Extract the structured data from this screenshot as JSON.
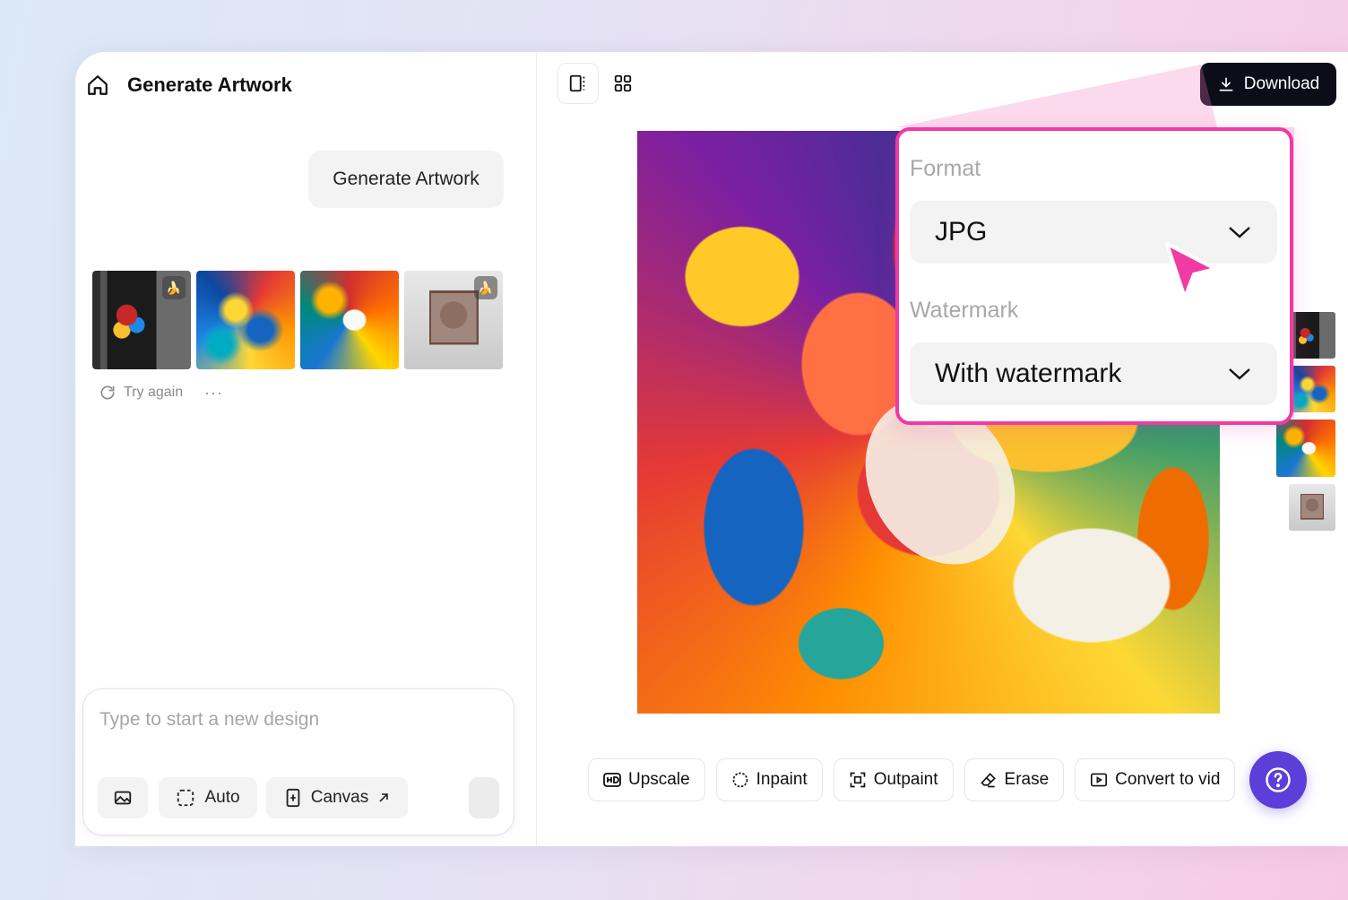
{
  "header": {
    "title": "Generate Artwork"
  },
  "chat": {
    "user_message": "Generate Artwork",
    "try_again_label": "Try again",
    "more_label": "···"
  },
  "composer": {
    "placeholder": "Type to start a new design",
    "auto_label": "Auto",
    "canvas_label": "Canvas"
  },
  "toolbar": {
    "download_label": "Download"
  },
  "popover": {
    "format_label": "Format",
    "format_value": "JPG",
    "watermark_label": "Watermark",
    "watermark_value": "With watermark"
  },
  "actions": [
    {
      "label": "Upscale",
      "icon": "hd-icon"
    },
    {
      "label": "Inpaint",
      "icon": "brush-icon"
    },
    {
      "label": "Outpaint",
      "icon": "expand-icon"
    },
    {
      "label": "Erase",
      "icon": "eraser-icon"
    },
    {
      "label": "Convert to vid",
      "icon": "video-icon"
    }
  ],
  "colors": {
    "accent_pink": "#f03aa4",
    "help_purple": "#5b3fd8",
    "download_bg": "#0d0d1a"
  }
}
